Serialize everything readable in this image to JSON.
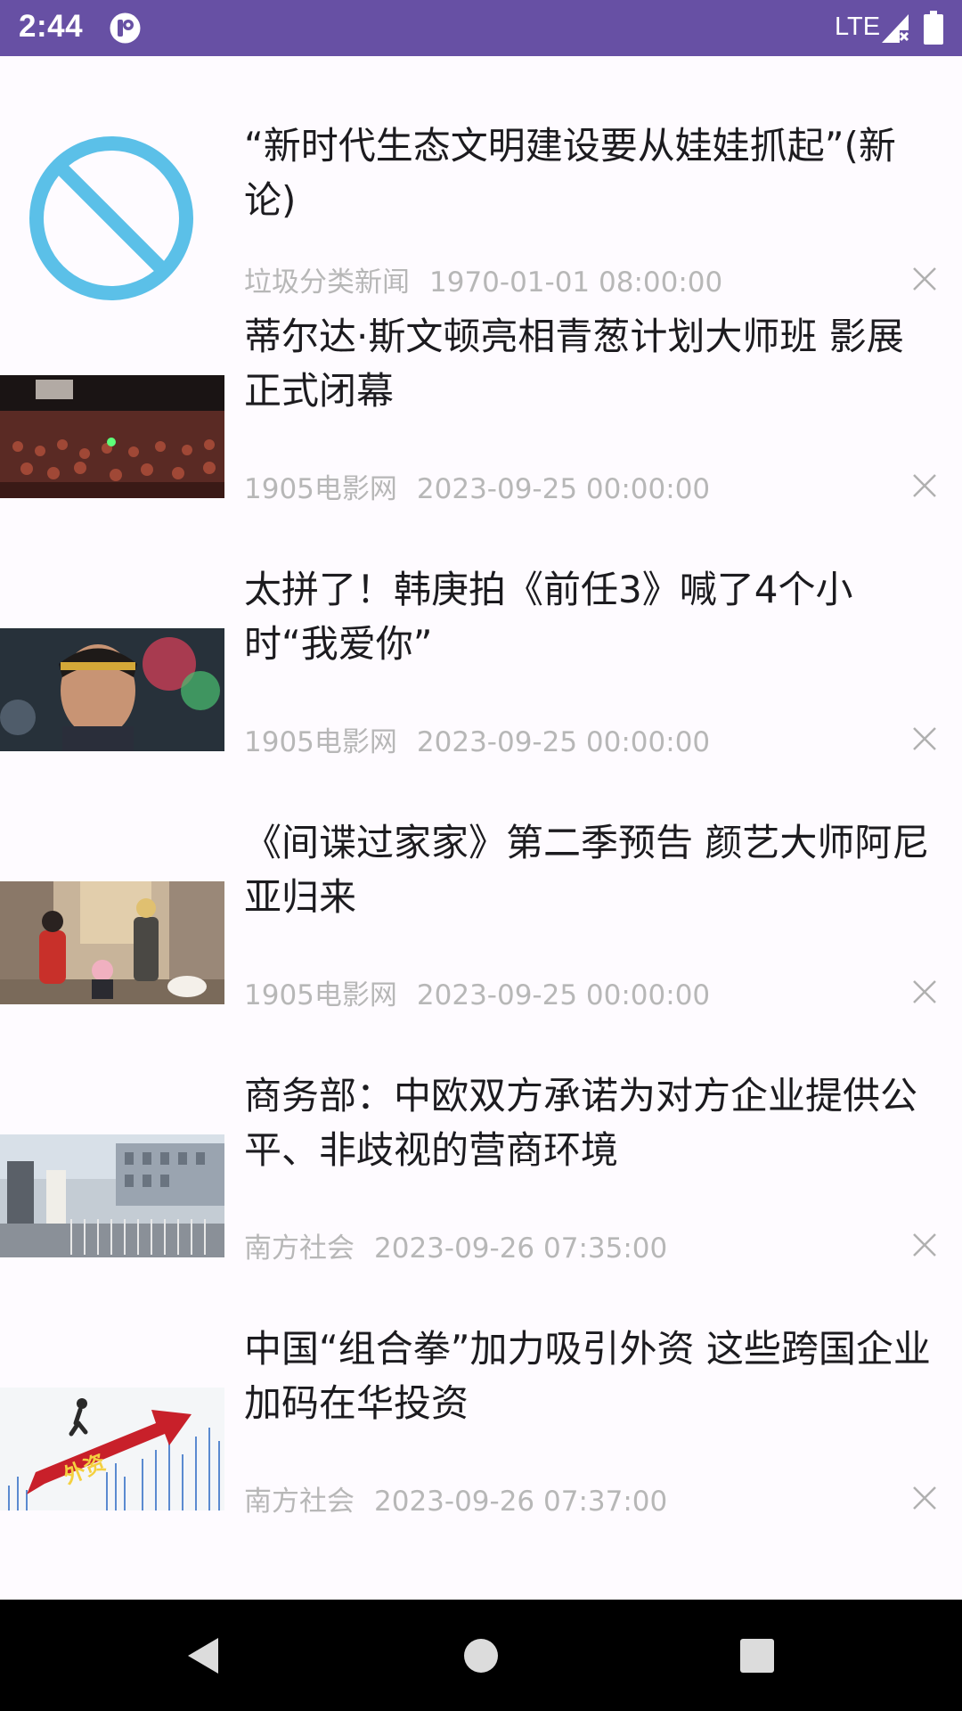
{
  "status_bar": {
    "time": "2:44",
    "network": "LTE",
    "bg_color": "#6750a4"
  },
  "news": [
    {
      "title": "“新时代生态文明建设要从娃娃抓起”(新论)",
      "source": "垃圾分类新闻",
      "time": "1970-01-01 08:00:00",
      "thumb": "no-image-placeholder"
    },
    {
      "title": "蒂尔达·斯文顿亮相青葱计划大师班 影展正式闭幕",
      "source": "1905电影网",
      "time": "2023-09-25 00:00:00",
      "thumb": "cinema-audience-photo"
    },
    {
      "title": "太拼了！韩庚拍《前任3》喊了4个小时“我爱你”",
      "source": "1905电影网",
      "time": "2023-09-25 00:00:00",
      "thumb": "actor-portrait-photo"
    },
    {
      "title": "《间谍过家家》第二季预告 颜艺大师阿尼亚归来",
      "source": "1905电影网",
      "time": "2023-09-25 00:00:00",
      "thumb": "anime-family-illustration"
    },
    {
      "title": "商务部：中欧双方承诺为对方企业提供公平、非歧视的营商环境",
      "source": "南方社会",
      "time": "2023-09-26 07:35:00",
      "thumb": "ministry-gate-photo"
    },
    {
      "title": "中国“组合拳”加力吸引外资 这些跨国企业加码在华投资",
      "source": "南方社会",
      "time": "2023-09-26 07:37:00",
      "thumb": "foreign-investment-graphic",
      "thumb_text": "外资"
    }
  ],
  "colors": {
    "title": "#1c1b1f",
    "meta": "#b7b7b7",
    "placeholder": "#5bc0e8",
    "background": "#fefbff"
  },
  "icons": {
    "close": "close-icon",
    "nav_back": "back-triangle-icon",
    "nav_home": "home-circle-icon",
    "nav_recents": "recents-square-icon"
  }
}
